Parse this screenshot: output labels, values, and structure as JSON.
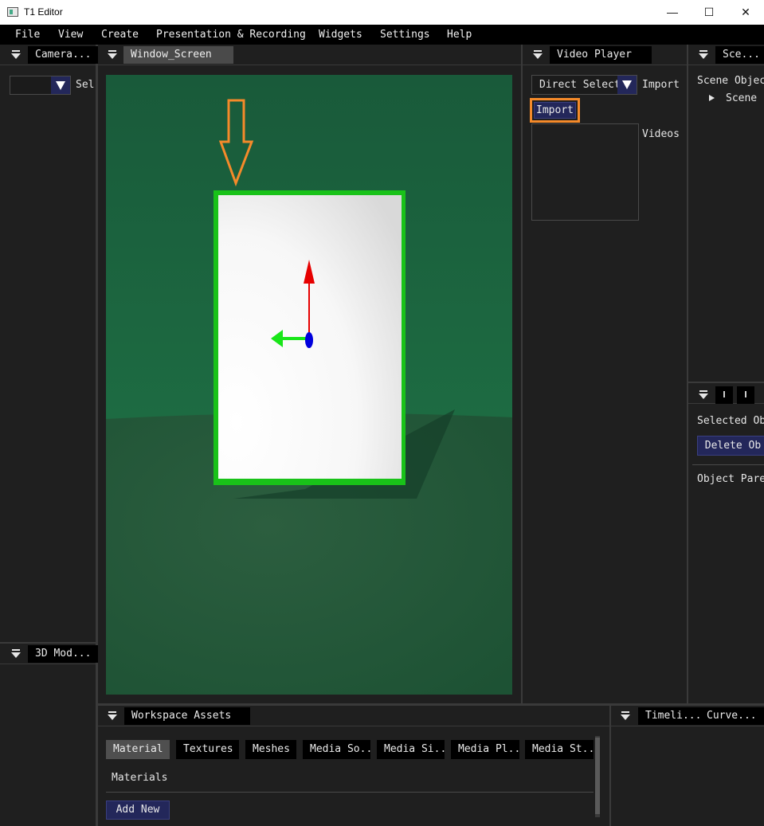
{
  "window": {
    "title": "T1 Editor",
    "minimize_glyph": "—",
    "maximize_glyph": "☐",
    "close_glyph": "✕"
  },
  "menu": [
    "File",
    "View",
    "Create",
    "Presentation & Recording",
    "Widgets",
    "Settings",
    "Help"
  ],
  "left_panel": {
    "tab": "Camera...",
    "select_label": "Sel"
  },
  "left_bottom_panel": {
    "tab": "3D Mod..."
  },
  "viewport": {
    "tab": "Window_Screen",
    "background_color": "#1a5c3b",
    "screen_border_color": "#19c219",
    "highlight_color": "#f58a2a",
    "gizmo_up_color": "#e60000",
    "gizmo_left_color": "#19e619",
    "gizmo_center_color": "#0000dd"
  },
  "video_player": {
    "tab": "Video Player",
    "dropdown_value": "Direct Select",
    "dropdown_label": "Import",
    "import_button": "Import",
    "videos_label": "Videos"
  },
  "scene_panel": {
    "tab": "Sce...",
    "objects_label": "Scene Objec",
    "tree_item": "Scene"
  },
  "properties_panel": {
    "selected_label": "Selected Ob",
    "delete_button": "Delete Ob",
    "parent_label": "Object Pare"
  },
  "assets_panel": {
    "tab": "Workspace Assets",
    "tabs": [
      "Material",
      "Textures",
      "Meshes",
      "Media So...",
      "Media Si...",
      "Media Pl...",
      "Media St..."
    ],
    "section_label": "Materials",
    "add_button": "Add New"
  },
  "timeline_panel": {
    "tabs": [
      "Timeli...",
      "Curve..."
    ]
  }
}
